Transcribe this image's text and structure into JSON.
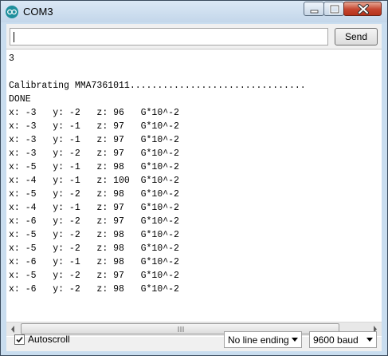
{
  "window": {
    "title": "COM3"
  },
  "input": {
    "value": ""
  },
  "toolbar": {
    "send_label": "Send"
  },
  "console": {
    "lines": [
      "3",
      "",
      "Calibrating MMA7361011................................",
      "DONE",
      "x: -3   y: -2   z: 96   G*10^-2",
      "x: -3   y: -1   z: 97   G*10^-2",
      "x: -3   y: -1   z: 97   G*10^-2",
      "x: -3   y: -2   z: 97   G*10^-2",
      "x: -5   y: -1   z: 98   G*10^-2",
      "x: -4   y: -1   z: 100  G*10^-2",
      "x: -5   y: -2   z: 98   G*10^-2",
      "x: -4   y: -1   z: 97   G*10^-2",
      "x: -6   y: -2   z: 97   G*10^-2",
      "x: -5   y: -2   z: 98   G*10^-2",
      "x: -5   y: -2   z: 98   G*10^-2",
      "x: -6   y: -1   z: 98   G*10^-2",
      "x: -5   y: -2   z: 97   G*10^-2",
      "x: -6   y: -2   z: 98   G*10^-2"
    ]
  },
  "footer": {
    "autoscroll_label": "Autoscroll",
    "autoscroll_checked": true,
    "line_ending": "No line ending",
    "baud_rate": "9600 baud"
  }
}
